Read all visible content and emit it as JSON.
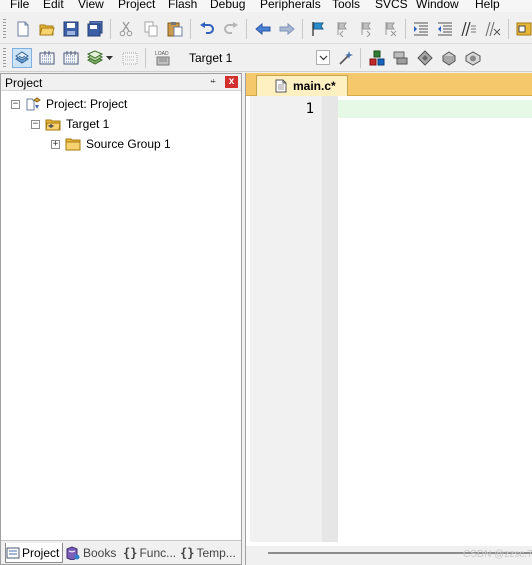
{
  "menu": [
    "File",
    "Edit",
    "View",
    "Project",
    "Flash",
    "Debug",
    "Peripherals",
    "Tools",
    "SVCS",
    "Window",
    "Help"
  ],
  "toolbar1": {
    "icons": [
      "new-file-icon",
      "open-folder-icon",
      "save-icon",
      "save-all-icon",
      "cut-icon",
      "copy-icon",
      "paste-icon",
      "undo-icon",
      "redo-icon",
      "navigate-back-icon",
      "navigate-forward-icon",
      "bookmark-flag-icon",
      "bookmark-prev-icon",
      "bookmark-next-icon",
      "bookmark-clear-icon",
      "indent-icon",
      "outdent-icon",
      "comment-icon",
      "uncomment-icon",
      "find-in-files-icon"
    ]
  },
  "toolbar2": {
    "icons": [
      "translate-icon",
      "build-icon",
      "rebuild-icon",
      "batch-build-icon",
      "stop-build-icon",
      "download-load-icon",
      "target-options-icon",
      "manage-project-icon",
      "manage-rte-icon",
      "select-packs-icon",
      "pack-installer-icon",
      "event-recorder-icon"
    ],
    "load_label": "LOAD",
    "target_value": "Target 1"
  },
  "project_panel": {
    "title": "Project",
    "pin_glyph": "⍅",
    "close_glyph": "x",
    "tree": [
      {
        "label": "Project: Project",
        "expander": "−",
        "icon": "project-root-icon"
      },
      {
        "label": "Target 1",
        "expander": "−",
        "icon": "target-folder-icon"
      },
      {
        "label": "Source Group 1",
        "expander": "+",
        "icon": "folder-icon"
      }
    ],
    "bottom_tabs": [
      {
        "label": "Project",
        "icon": "project-tab-icon"
      },
      {
        "label": "Books",
        "icon": "books-tab-icon"
      },
      {
        "label": "Func...",
        "glyph": "{}"
      },
      {
        "label": "Temp...",
        "glyph": "{}"
      }
    ]
  },
  "editor": {
    "tab_label": "main.c*",
    "line_numbers": [
      "1"
    ],
    "watermark": "CSDN @zzsc.79"
  },
  "colors": {
    "editor_tabbar": "#f5c86b",
    "current_line": "#e6f8e6",
    "panel_close": "#d32f2f"
  }
}
